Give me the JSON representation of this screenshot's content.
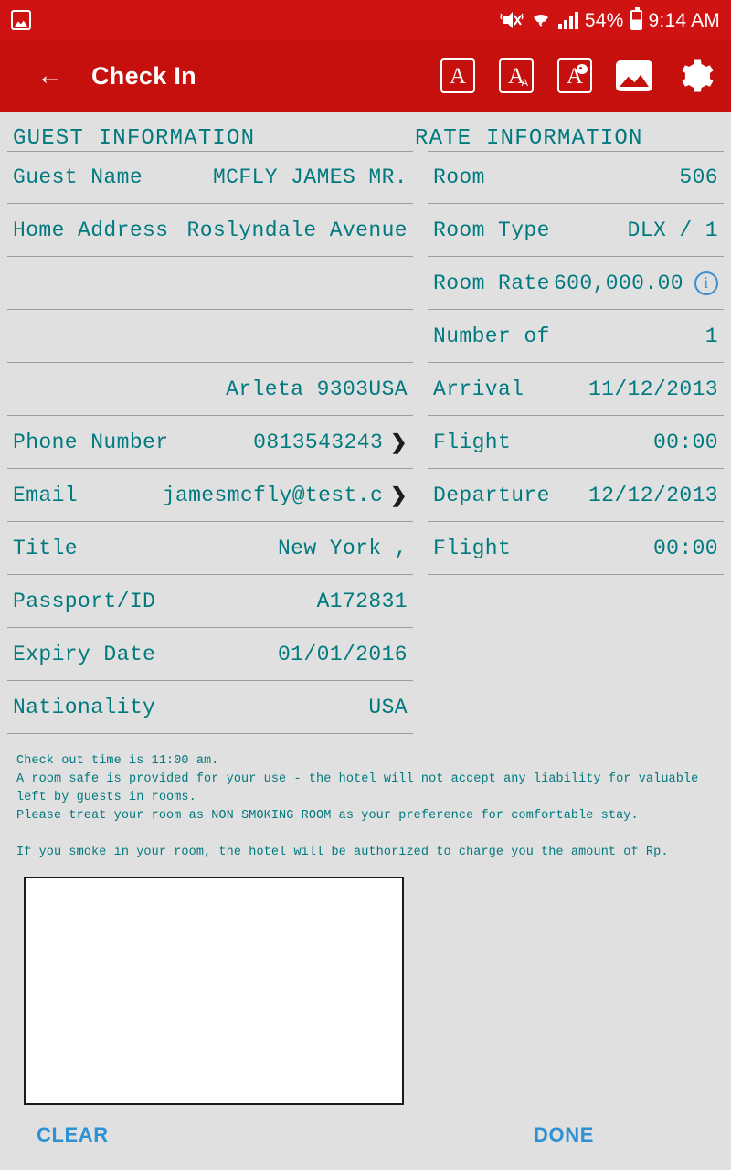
{
  "status_bar": {
    "screenshot_icon": "image-icon",
    "mute_icon": "mute-vibrate-icon",
    "wifi_icon": "wifi-icon",
    "signal_icon": "signal-bars-icon",
    "battery_percent": "54%",
    "battery_icon": "battery-icon",
    "time": "9:14 AM"
  },
  "app_bar": {
    "back_icon": "back-arrow-icon",
    "title": "Check In",
    "actions": [
      {
        "name": "font-face-button",
        "glyph": "A"
      },
      {
        "name": "font-size-button",
        "glyph": "A",
        "sub": "A"
      },
      {
        "name": "font-color-button",
        "glyph": "A"
      },
      {
        "name": "image-button"
      },
      {
        "name": "settings-button"
      }
    ]
  },
  "sections": {
    "guest_information": {
      "title": "GUEST INFORMATION",
      "rows": [
        {
          "label": "Guest Name",
          "value": "MCFLY JAMES MR."
        },
        {
          "label": "Home Address",
          "value": "Roslyndale Avenue"
        },
        {
          "label": "",
          "value": ""
        },
        {
          "label": "",
          "value": ""
        },
        {
          "label": "",
          "value": "Arleta 9303USA"
        },
        {
          "label": "Phone Number",
          "value": "0813543243",
          "chevron": "❯"
        },
        {
          "label": "Email",
          "value": "jamesmcfly@test.c",
          "chevron": "❯"
        },
        {
          "label": "Title",
          "value": "New York ,"
        },
        {
          "label": "Passport/ID",
          "value": "A172831"
        },
        {
          "label": "Expiry Date",
          "value": "01/01/2016"
        },
        {
          "label": "Nationality",
          "value": "USA"
        }
      ]
    },
    "rate_information": {
      "title": "RATE INFORMATION",
      "rows": [
        {
          "label": "Room",
          "value": "506"
        },
        {
          "label": "Room Type",
          "value": "DLX / 1"
        },
        {
          "label": "Room Rate",
          "value": "600,000.00",
          "info": "i"
        },
        {
          "label": "Number of",
          "value": "1"
        },
        {
          "label": "Arrival",
          "value": "11/12/2013"
        },
        {
          "label": "Flight",
          "value": "00:00"
        },
        {
          "label": "Departure",
          "value": "12/12/2013"
        },
        {
          "label": "Flight",
          "value": "00:00"
        }
      ]
    }
  },
  "terms": "Check out time is 11:00 am.\nA room safe is provided for your use - the hotel will not accept any liability for valuable\nleft by guests in rooms.\nPlease treat your room as NON SMOKING ROOM as your preference for comfortable stay.\n\nIf you smoke in your room, the hotel will be authorized to charge you the amount of Rp.",
  "signature": {
    "value": "",
    "clear_label": "CLEAR",
    "done_label": "DONE"
  },
  "colors": {
    "status_bar": "#cf1212",
    "app_bar": "#c5100d",
    "page_bg": "#e0e0e0",
    "teal_text": "#00797f",
    "link_blue": "#2e91d4",
    "info_blue": "#3f8fd0",
    "divider": "#9e9e9e"
  }
}
